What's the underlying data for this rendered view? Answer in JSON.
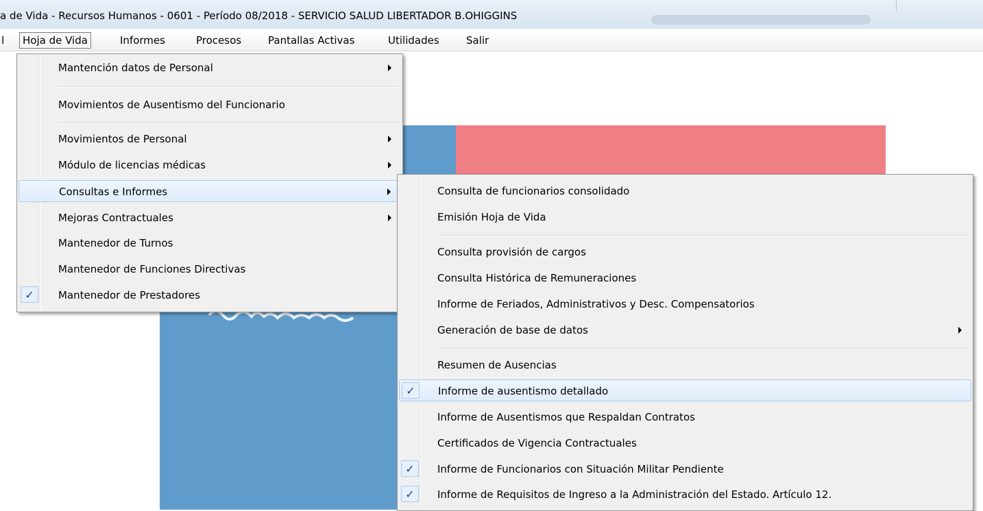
{
  "window": {
    "title": "a de Vida - Recursos Humanos - 0601 - Período 08/2018 - SERVICIO SALUD LIBERTADOR B.OHIGGINS"
  },
  "menubar": {
    "items": [
      {
        "label": "l"
      },
      {
        "label": "Hoja de Vida"
      },
      {
        "label": "Informes"
      },
      {
        "label": "Procesos"
      },
      {
        "label": "Pantallas Activas"
      },
      {
        "label": "Utilidades"
      },
      {
        "label": "Salir"
      }
    ]
  },
  "hoja_de_vida_menu": {
    "items": [
      {
        "label": "Mantención datos de Personal",
        "submenu": true
      },
      {
        "label": "Movimientos de Ausentismo del Funcionario"
      },
      {
        "label": "Movimientos de Personal",
        "submenu": true
      },
      {
        "label": "Módulo de licencias médicas",
        "submenu": true
      },
      {
        "label": "Consultas e Informes",
        "submenu": true,
        "highlighted": true
      },
      {
        "label": "Mejoras Contractuales",
        "submenu": true
      },
      {
        "label": "Mantenedor de Turnos"
      },
      {
        "label": "Mantenedor de Funciones Directivas"
      },
      {
        "label": "Mantenedor de Prestadores",
        "checked": true
      }
    ]
  },
  "consultas_submenu": {
    "items": [
      {
        "label": "Consulta de funcionarios consolidado"
      },
      {
        "label": "Emisión Hoja de Vida"
      },
      {
        "label": "Consulta provisión de cargos"
      },
      {
        "label": "Consulta Histórica de Remuneraciones"
      },
      {
        "label": "Informe de Feriados, Administrativos y Desc. Compensatorios"
      },
      {
        "label": "Generación de base de datos",
        "submenu": true
      },
      {
        "label": "Resumen de Ausencias"
      },
      {
        "label": "Informe de ausentismo detallado",
        "checked": true,
        "highlighted": true
      },
      {
        "label": "Informe de Ausentismos que Respaldan Contratos"
      },
      {
        "label": "Certificados de Vigencia Contractuales"
      },
      {
        "label": "Informe de Funcionarios con Situación Militar Pendiente",
        "checked": true
      },
      {
        "label": "Informe de Requisitos de Ingreso a la Administración del Estado. Artículo 12.",
        "checked": true
      }
    ]
  },
  "icons": {
    "check": "✓",
    "submenu_arrow": "chevron-right-icon"
  },
  "colors": {
    "background_blue": "#5f9ccc",
    "background_pink": "#ef7e85",
    "menu_bg": "#f0f0f0",
    "highlight_border": "#a8cbef"
  }
}
